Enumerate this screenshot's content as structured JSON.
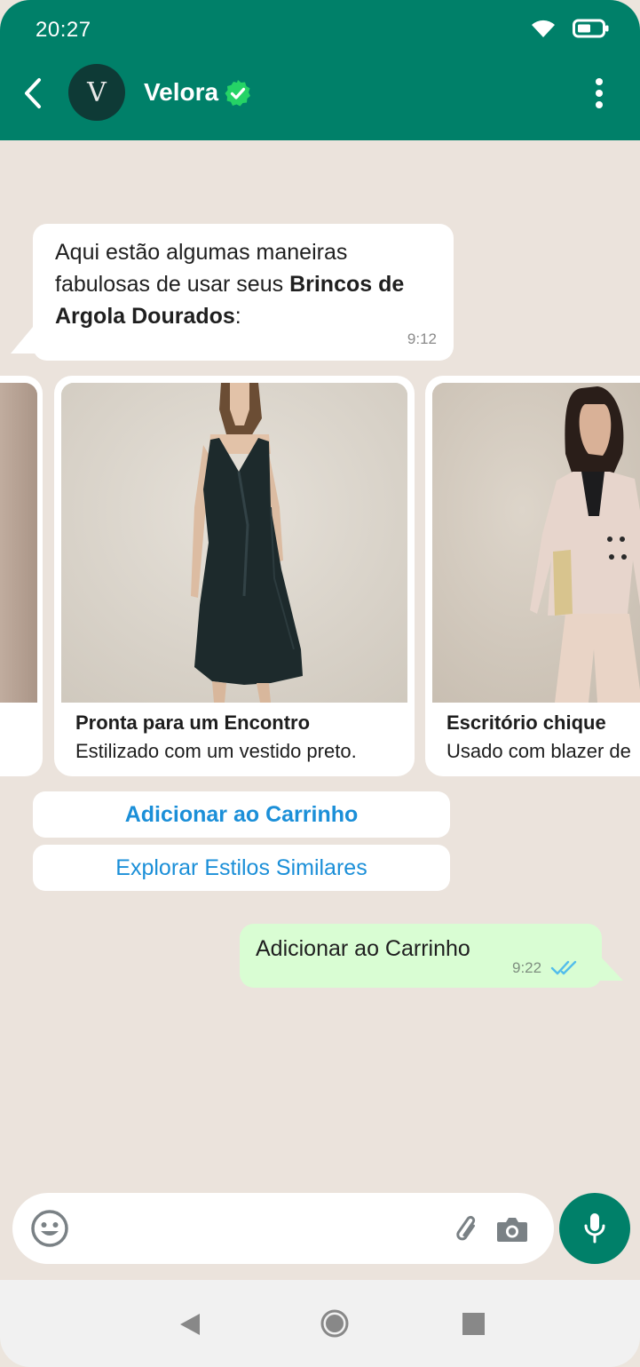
{
  "status_bar": {
    "time": "20:27"
  },
  "header": {
    "avatar_letter": "V",
    "contact_name": "Velora",
    "colors": {
      "header_bg": "#008069",
      "verified": "#25d366"
    },
    "icons": [
      "back-arrow-icon",
      "verified-check-icon",
      "more-vert-icon",
      "wifi-icon",
      "battery-icon"
    ]
  },
  "messages": {
    "incoming": {
      "text_prefix": "Aqui estão algumas maneiras fabulosas de usar seus ",
      "text_bold": "Brincos de Argola Dourados",
      "text_suffix": ":",
      "time": "9:12"
    },
    "carousel": [
      {
        "title": "Pronta para um Encontro",
        "subtitle": "Estilizado com um vestido preto."
      },
      {
        "title": "Escritório chique",
        "subtitle": "Usado com blazer de"
      }
    ],
    "quick_replies": {
      "primary": "Adicionar ao Carrinho",
      "secondary": "Explorar Estilos Similares"
    },
    "outgoing": {
      "text": "Adicionar ao Carrinho",
      "time": "9:22"
    }
  },
  "composer": {
    "icons": [
      "emoji-icon",
      "attach-icon",
      "camera-icon",
      "mic-icon"
    ]
  },
  "navbar": {
    "icons": [
      "nav-back-icon",
      "nav-home-icon",
      "nav-recents-icon"
    ]
  }
}
